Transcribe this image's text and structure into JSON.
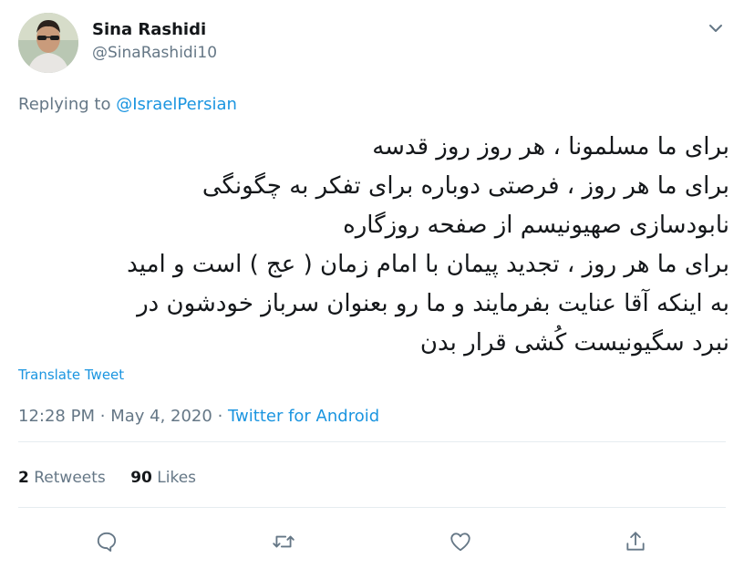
{
  "author": {
    "display_name": "Sina Rashidi",
    "handle": "@SinaRashidi10"
  },
  "reply": {
    "prefix": "Replying to",
    "target": "@IsraelPersian"
  },
  "tweet": {
    "lines": [
      "برای ما مسلمونا ، هر روز روز قدسه",
      "برای ما هر روز ، فرصتی دوباره برای تفکر به چگونگی",
      "نابودسازی صهیونیسم از صفحه روزگاره",
      "برای ما هر روز ، تجدید پیمان با امام زمان ( عج ) است و امید",
      "به اینکه آقا عنایت بفرمایند و ما رو بعنوان سرباز خودشون در",
      "نبرد سگیونیست کُشی قرار بدن"
    ],
    "translate_label": "Translate Tweet"
  },
  "meta": {
    "time": "12:28 PM",
    "separator": "·",
    "date": "May 4, 2020",
    "source": "Twitter for Android"
  },
  "stats": {
    "retweets_count": "2",
    "retweets_label": "Retweets",
    "likes_count": "90",
    "likes_label": "Likes"
  },
  "actions": [
    "reply-icon",
    "retweet-icon",
    "like-icon",
    "share-icon"
  ],
  "colors": {
    "link": "#1b95e0",
    "muted": "#657786",
    "text": "#14171a",
    "divider": "#e6ecf0"
  }
}
